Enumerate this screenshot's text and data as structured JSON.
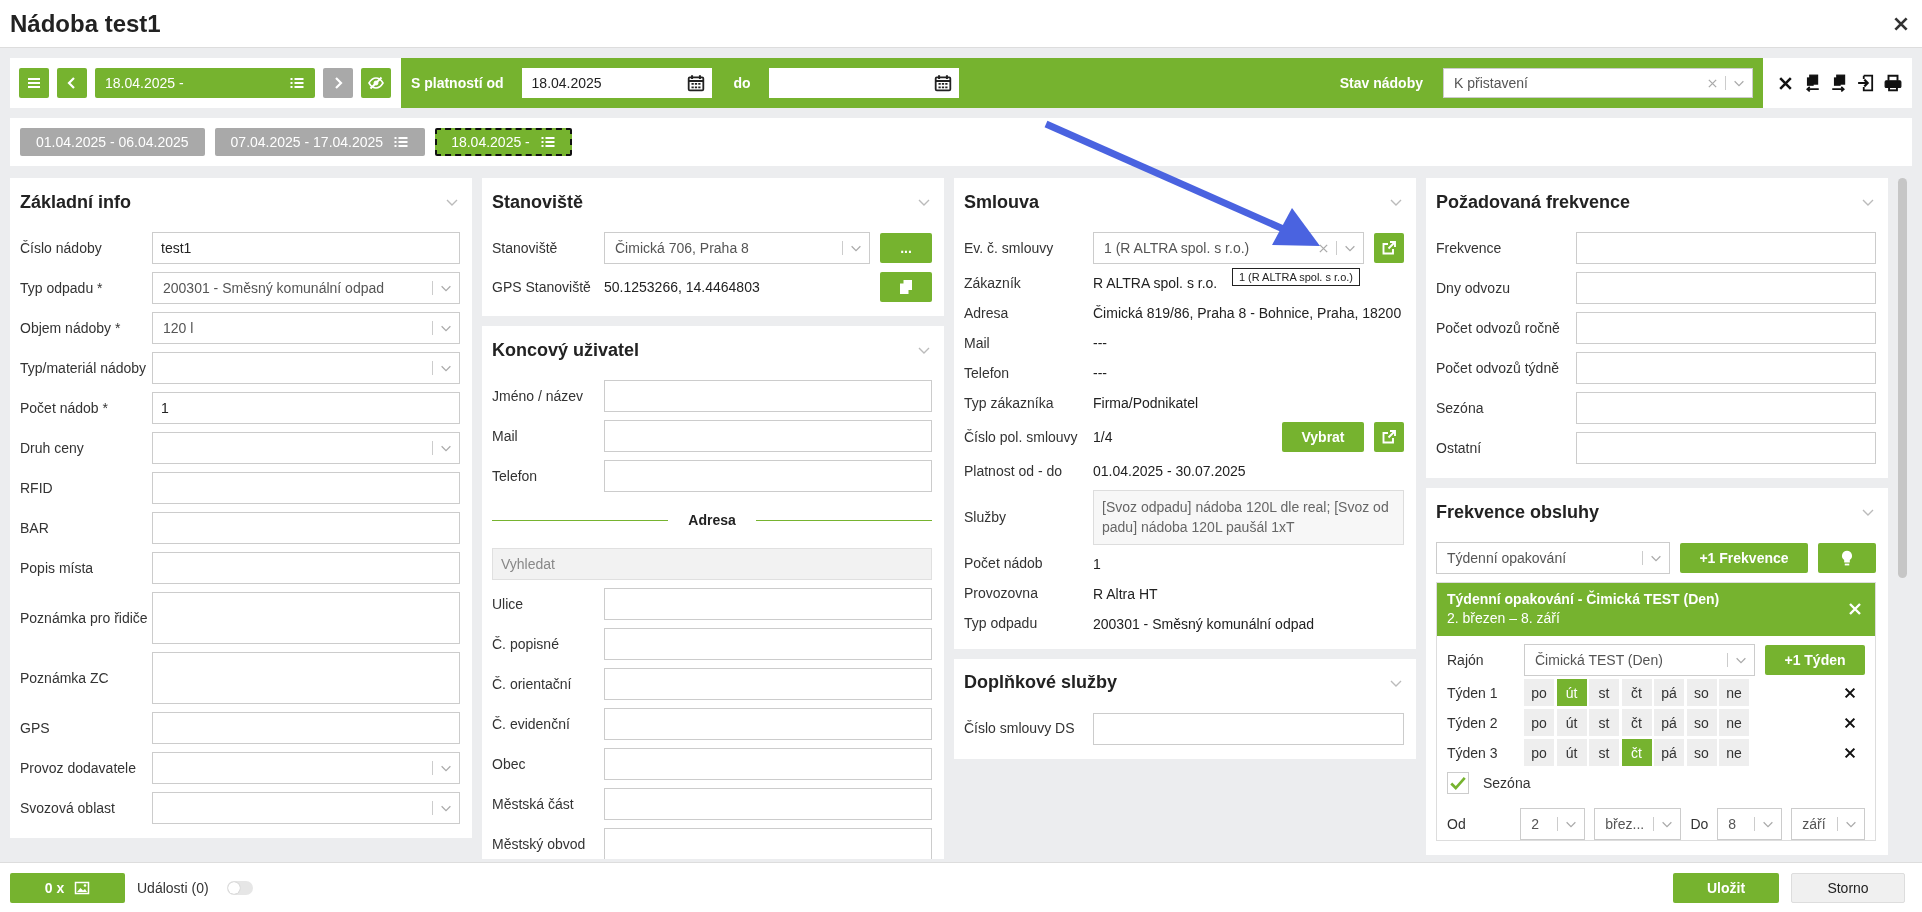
{
  "window": {
    "title": "Nádoba test1"
  },
  "toolbar": {
    "period": "18.04.2025 -",
    "next_button": {
      "disabled": true
    },
    "valid_from": {
      "label": "S platností od",
      "value": "18.04.2025"
    },
    "valid_to": {
      "label": "do"
    },
    "state": {
      "label": "Stav nádoby",
      "value": "K přistavení",
      "clearable": true
    }
  },
  "periods": [
    {
      "label": "01.04.2025 - 06.04.2025",
      "list_icon": false,
      "selected": false
    },
    {
      "label": "07.04.2025 - 17.04.2025",
      "list_icon": true,
      "selected": false
    },
    {
      "label": "18.04.2025 -",
      "list_icon": true,
      "selected": true
    }
  ],
  "columns": [
    {
      "panels": [
        {
          "kind": "form",
          "title": "Základní info",
          "rows": [
            {
              "kind": "text",
              "label": "Číslo nádoby",
              "value": "test1"
            },
            {
              "kind": "select",
              "label": "Typ odpadu *",
              "value": "200301 - Směsný komunální odpad"
            },
            {
              "kind": "select",
              "label": "Objem nádoby *",
              "value": "120 l"
            },
            {
              "kind": "select",
              "label": "Typ/materiál nádoby"
            },
            {
              "kind": "text",
              "label": "Počet nádob *",
              "value": "1"
            },
            {
              "kind": "select",
              "label": "Druh ceny"
            },
            {
              "kind": "text",
              "label": "RFID"
            },
            {
              "kind": "text",
              "label": "BAR"
            },
            {
              "kind": "text",
              "label": "Popis místa"
            },
            {
              "kind": "textarea",
              "label": "Poznámka pro řidiče"
            },
            {
              "kind": "textarea",
              "label": "Poznámka ZC"
            },
            {
              "kind": "text",
              "label": "GPS"
            },
            {
              "kind": "select",
              "label": "Provoz dodavatele"
            },
            {
              "kind": "select",
              "label": "Svozová oblast"
            }
          ]
        }
      ]
    },
    {
      "panels": [
        {
          "kind": "form",
          "title": "Stanoviště",
          "rows": [
            {
              "kind": "select",
              "label": "Stanoviště",
              "value": "Čimická 706, Praha 8",
              "buttons": [
                {
                  "kind": "more",
                  "label": "..."
                }
              ]
            },
            {
              "kind": "info",
              "label": "GPS Stanoviště",
              "value": "50.1253266, 14.4464803",
              "buttons": [
                {
                  "kind": "copy"
                }
              ]
            }
          ]
        },
        {
          "kind": "form",
          "title": "Koncový uživatel",
          "rows": [
            {
              "kind": "text",
              "label": "Jméno / název"
            },
            {
              "kind": "text",
              "label": "Mail"
            },
            {
              "kind": "text",
              "label": "Telefon"
            },
            {
              "kind": "divider",
              "label": "Adresa"
            },
            {
              "kind": "search",
              "placeholder": "Vyhledat"
            },
            {
              "kind": "text",
              "label": "Ulice"
            },
            {
              "kind": "text",
              "label": "Č. popisné"
            },
            {
              "kind": "text",
              "label": "Č. orientační"
            },
            {
              "kind": "text",
              "label": "Č. evidenční"
            },
            {
              "kind": "text",
              "label": "Obec"
            },
            {
              "kind": "text",
              "label": "Městská část"
            },
            {
              "kind": "text",
              "label": "Městský obvod"
            }
          ]
        }
      ]
    },
    {
      "panels": [
        {
          "kind": "form",
          "title": "Smlouva",
          "rows": [
            {
              "kind": "select",
              "label": "Ev. č. smlouvy",
              "value": "1 (R ALTRA spol. s r.o.)",
              "clearable": true,
              "buttons": [
                {
                  "kind": "link"
                }
              ],
              "tooltip": "1 (R ALTRA spol. s r.o.)"
            },
            {
              "kind": "info",
              "label": "Zákazník",
              "value": "R ALTRA spol. s r.o."
            },
            {
              "kind": "info",
              "label": "Adresa",
              "value": "Čimická 819/86, Praha 8 - Bohnice, Praha, 18200"
            },
            {
              "kind": "info",
              "label": "Mail",
              "value": "---"
            },
            {
              "kind": "info",
              "label": "Telefon",
              "value": "---"
            },
            {
              "kind": "info",
              "label": "Typ zákazníka",
              "value": "Firma/Podnikatel"
            },
            {
              "kind": "info",
              "label": "Číslo pol. smlouvy",
              "value": "1/4",
              "buttons": [
                {
                  "kind": "text",
                  "label": "Vybrat"
                },
                {
                  "kind": "link"
                }
              ]
            },
            {
              "kind": "info",
              "label": "Platnost od - do",
              "value": "01.04.2025 - 30.07.2025"
            },
            {
              "kind": "services",
              "label": "Služby",
              "value": "[Svoz odpadu] nádoba 120L dle real; [Svoz odpadu] nádoba 120L paušál 1xT"
            },
            {
              "kind": "info",
              "label": "Počet nádob",
              "value": "1"
            },
            {
              "kind": "info",
              "label": "Provozovna",
              "value": "R Altra HT"
            },
            {
              "kind": "info",
              "label": "Typ odpadu",
              "value": "200301 - Směsný komunální odpad"
            }
          ]
        },
        {
          "kind": "form",
          "title": "Doplňkové služby",
          "rows": [
            {
              "kind": "text",
              "label": "Číslo smlouvy DS"
            }
          ]
        }
      ]
    },
    {
      "panels": [
        {
          "kind": "form",
          "title": "Požadovaná frekvence",
          "rows": [
            {
              "kind": "text",
              "label": "Frekvence"
            },
            {
              "kind": "text",
              "label": "Dny odvozu"
            },
            {
              "kind": "text",
              "label": "Počet odvozů ročně"
            },
            {
              "kind": "text",
              "label": "Počet odvozů týdně"
            },
            {
              "kind": "text",
              "label": "Sezóna"
            },
            {
              "kind": "text",
              "label": "Ostatní"
            }
          ]
        },
        {
          "kind": "frequency",
          "title": "Frekvence obsluhy",
          "repeat": "Týdenní opakování",
          "add_label": "+1 Frekvence",
          "card": {
            "title": "Týdenní opakování - Čimická TEST (Den)",
            "dates": "2. březen – 8. září",
            "rajon_label": "Rajón",
            "rajon": "Čimická TEST (Den)",
            "add_week": "+1 Týden",
            "weeks": [
              {
                "label": "Týden 1",
                "days": [
                  {
                    "label": "po",
                    "selected": false
                  },
                  {
                    "label": "út",
                    "selected": true
                  },
                  {
                    "label": "st",
                    "selected": false
                  },
                  {
                    "label": "čt",
                    "selected": false
                  },
                  {
                    "label": "pá",
                    "selected": false
                  },
                  {
                    "label": "so",
                    "selected": false
                  },
                  {
                    "label": "ne",
                    "selected": false
                  }
                ]
              },
              {
                "label": "Týden 2",
                "days": [
                  {
                    "label": "po",
                    "selected": false
                  },
                  {
                    "label": "út",
                    "selected": false
                  },
                  {
                    "label": "st",
                    "selected": false
                  },
                  {
                    "label": "čt",
                    "selected": false
                  },
                  {
                    "label": "pá",
                    "selected": false
                  },
                  {
                    "label": "so",
                    "selected": false
                  },
                  {
                    "label": "ne",
                    "selected": false
                  }
                ]
              },
              {
                "label": "Týden 3",
                "days": [
                  {
                    "label": "po",
                    "selected": false
                  },
                  {
                    "label": "út",
                    "selected": false
                  },
                  {
                    "label": "st",
                    "selected": false
                  },
                  {
                    "label": "čt",
                    "selected": true
                  },
                  {
                    "label": "pá",
                    "selected": false
                  },
                  {
                    "label": "so",
                    "selected": false
                  },
                  {
                    "label": "ne",
                    "selected": false
                  }
                ]
              }
            ],
            "season": {
              "label": "Sezóna",
              "checked": true
            },
            "range": {
              "from_label": "Od",
              "from_day": "2",
              "from_month": "břez...",
              "to_label": "Do",
              "to_day": "8",
              "to_month": "září"
            }
          }
        }
      ]
    }
  ],
  "footer": {
    "photos": "0 x",
    "events": {
      "label": "Události (0)",
      "on": false
    },
    "save": "Uložit",
    "cancel": "Storno"
  }
}
